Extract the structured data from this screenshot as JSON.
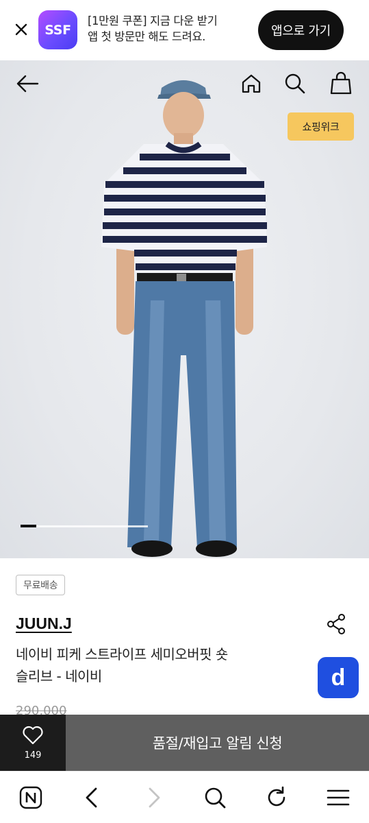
{
  "banner": {
    "close_icon": "close-icon",
    "logo_text": "SSF",
    "line1": "[1만원 쿠폰] 지금 다운 받기",
    "line2": "앱 첫 방문만 해도 드려요.",
    "open_app_label": "앱으로 가기"
  },
  "hero": {
    "icons": [
      "back-arrow-icon",
      "home-icon",
      "search-icon",
      "shopping-bag-icon"
    ],
    "badge": "쇼핑위크",
    "slide_indicator": {
      "current": 1,
      "total": 8
    }
  },
  "product": {
    "shipping_tag": "무료배송",
    "brand": "JUUN.J",
    "name_line1": "네이비 피케 스트라이프 세미오버핏 숏",
    "name_line2": "슬리브 - 네이비",
    "old_price": "290,000",
    "float_button": "d"
  },
  "action_bar": {
    "like_count": "149",
    "restock_label": "품절/재입고 알림 신청"
  },
  "browser": {
    "icons": [
      "naver-n-icon",
      "back-icon",
      "forward-icon",
      "search-icon",
      "refresh-icon",
      "menu-icon"
    ]
  },
  "colors": {
    "badge": "#f6c75e",
    "float_button": "#1f4fe0",
    "action_bar": "#5f5f5f",
    "like_bg": "#1c1c1c"
  }
}
